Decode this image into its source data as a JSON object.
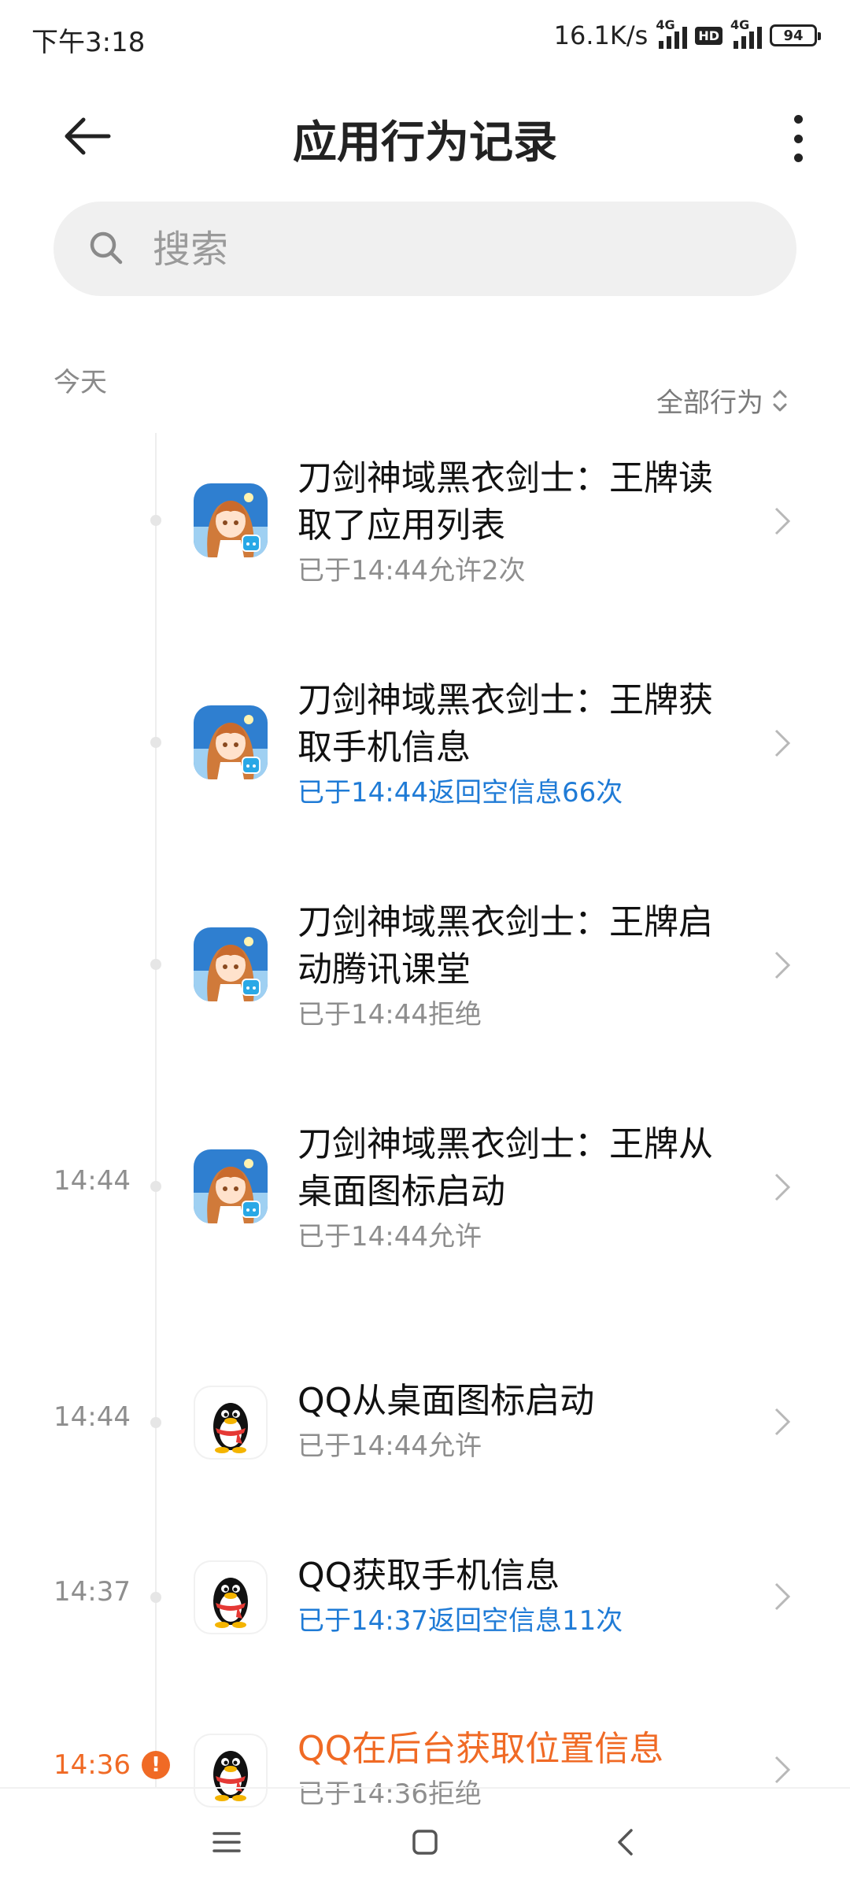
{
  "status_bar": {
    "time": "下午3:18",
    "speed": "16.1K/s",
    "network_1": "4G",
    "hd": "HD",
    "network_2": "4G",
    "battery": "94"
  },
  "header": {
    "title": "应用行为记录"
  },
  "search": {
    "placeholder": "搜索"
  },
  "section": {
    "today": "今天",
    "filter_label": "全部行为"
  },
  "records": [
    {
      "time": "",
      "title": "刀剑神域黑衣剑士：王牌读取了应用列表",
      "subtitle": "已于14:44允许2次",
      "icon": "sword-art-online-app-icon"
    },
    {
      "time": "",
      "title": "刀剑神域黑衣剑士：王牌获取手机信息",
      "subtitle": "已于14:44返回空信息66次",
      "icon": "sword-art-online-app-icon"
    },
    {
      "time": "",
      "title": "刀剑神域黑衣剑士：王牌启动腾讯课堂",
      "subtitle": "已于14:44拒绝",
      "icon": "sword-art-online-app-icon"
    },
    {
      "time": "14:44",
      "title": "刀剑神域黑衣剑士：王牌从桌面图标启动",
      "subtitle": "已于14:44允许",
      "icon": "sword-art-online-app-icon"
    },
    {
      "time": "14:44",
      "title": "QQ从桌面图标启动",
      "subtitle": "已于14:44允许",
      "icon": "qq-penguin-icon"
    },
    {
      "time": "14:37",
      "title": "QQ获取手机信息",
      "subtitle": "已于14:37返回空信息11次",
      "icon": "qq-penguin-icon"
    },
    {
      "time": "14:36",
      "title": "QQ在后台获取位置信息",
      "subtitle": "已于14:36拒绝",
      "icon": "qq-penguin-icon",
      "alert": "!"
    }
  ],
  "colors": {
    "accent_blue": "#1f7bd6",
    "warning_orange": "#f06a25",
    "muted_gray": "#8e8e8e"
  }
}
